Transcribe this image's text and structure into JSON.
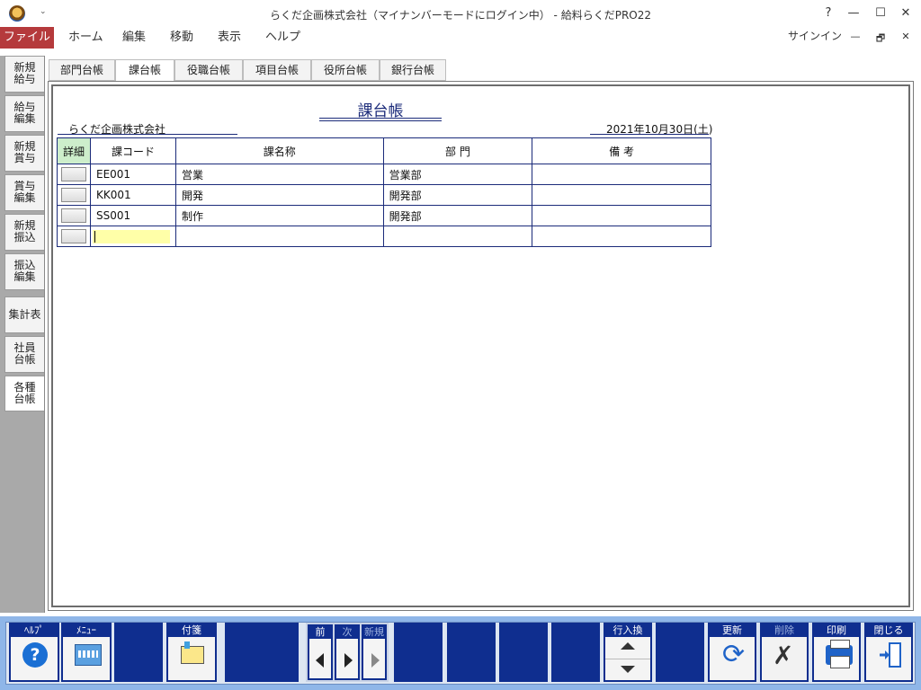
{
  "window": {
    "title": "らくだ企画株式会社（マイナンバーモードにログイン中） - 給料らくだPRO22",
    "qat_caret": "⌄",
    "help_glyph": "?",
    "minimize_glyph": "—",
    "maximize_glyph": "☐",
    "close_glyph": "✕"
  },
  "ribbon": {
    "file": "ファイル",
    "menus": [
      "ホーム",
      "編集",
      "移動",
      "表示",
      "ヘルプ"
    ],
    "signin": "サインイン",
    "min_glyph": "—",
    "restore_glyph": "🗗",
    "close_glyph": "✕"
  },
  "leftnav": [
    {
      "l1": "新規",
      "l2": "給与"
    },
    {
      "l1": "給与",
      "l2": "編集"
    },
    {
      "l1": "新規",
      "l2": "賞与"
    },
    {
      "l1": "賞与",
      "l2": "編集"
    },
    {
      "l1": "新規",
      "l2": "振込"
    },
    {
      "l1": "振込",
      "l2": "編集"
    },
    {
      "l1": "集計表",
      "l2": ""
    },
    {
      "l1": "社員",
      "l2": "台帳"
    },
    {
      "l1": "各種",
      "l2": "台帳"
    }
  ],
  "tabs": [
    "部門台帳",
    "課台帳",
    "役職台帳",
    "項目台帳",
    "役所台帳",
    "銀行台帳"
  ],
  "report": {
    "title": "課台帳",
    "company": "らくだ企画株式会社",
    "date": "2021年10月30日(土)"
  },
  "table": {
    "headers": [
      "詳細",
      "課コード",
      "課名称",
      "部 門",
      "備 考"
    ],
    "rows": [
      {
        "code": "EE001",
        "name": "営業",
        "dept": "営業部",
        "note": ""
      },
      {
        "code": "KK001",
        "name": "開発",
        "dept": "開発部",
        "note": ""
      },
      {
        "code": "SS001",
        "name": "制作",
        "dept": "開発部",
        "note": ""
      }
    ]
  },
  "toolbar": {
    "help": "ﾍﾙﾌﾟ",
    "menu": "ﾒﾆｭｰ",
    "memo": "付箋",
    "prev": "前",
    "next": "次",
    "new": "新規",
    "row_swap": "行入換",
    "update": "更新",
    "delete": "削除",
    "print": "印刷",
    "close": "閉じる",
    "help_glyph": "?",
    "refresh_glyph": "⟳",
    "delete_glyph": "✗"
  }
}
